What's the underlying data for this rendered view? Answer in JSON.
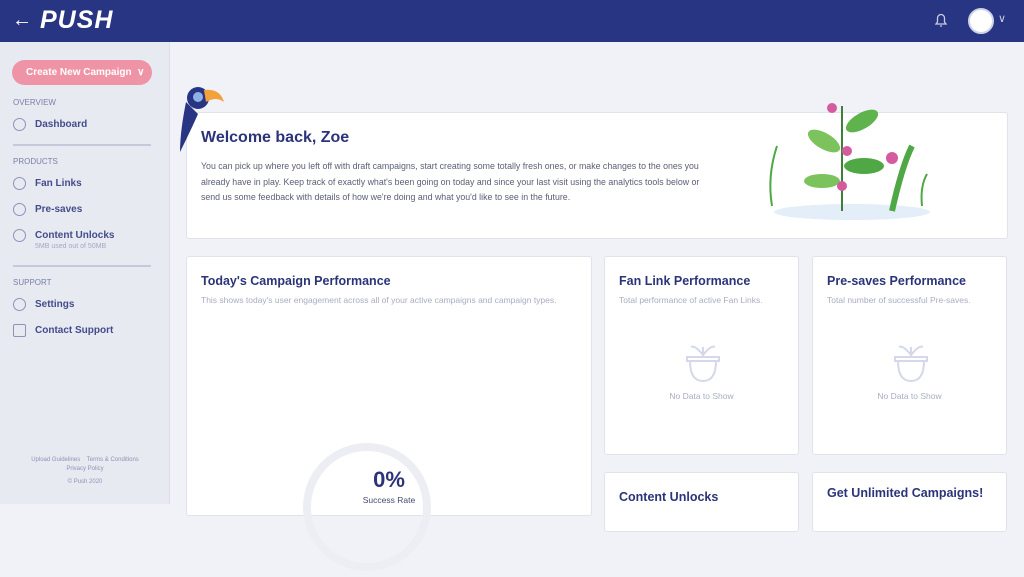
{
  "header": {
    "back_icon": "arrow-left-icon",
    "logo": "PUSH",
    "bell_icon": "bell-icon",
    "avatar_icon": "user-avatar",
    "menu_caret": "chevron-down-icon"
  },
  "sidebar": {
    "create_button": "Create New Campaign",
    "sections": [
      {
        "title": "OVERVIEW",
        "items": [
          {
            "label": "Dashboard",
            "icon": "dashboard-icon"
          }
        ]
      },
      {
        "title": "PRODUCTS",
        "items": [
          {
            "label": "Fan Links",
            "icon": "link-icon"
          },
          {
            "label": "Pre-saves",
            "icon": "presave-icon"
          },
          {
            "label": "Content Unlocks",
            "icon": "lock-icon",
            "sub": "5MB used out of 50MB"
          }
        ]
      },
      {
        "title": "SUPPORT",
        "items": [
          {
            "label": "Settings",
            "icon": "gear-icon"
          },
          {
            "label": "Contact Support",
            "icon": "chat-icon"
          }
        ]
      }
    ],
    "footer": {
      "upload": "Upload Guidelines",
      "terms": "Terms & Conditions",
      "privacy": "Privacy Policy",
      "copyright": "© Push 2020"
    }
  },
  "welcome": {
    "title": "Welcome back, Zoe",
    "text": "You can pick up where you left off with draft campaigns, start creating some totally fresh ones, or make changes to the ones you already have in play. Keep track of exactly what's been going on today and since your last visit using the analytics tools below or send us some feedback with details of how we're doing and what you'd like to see in the future."
  },
  "today": {
    "title": "Today's Campaign Performance",
    "desc": "This shows today's user engagement across all of your active campaigns and campaign types.",
    "value": "0%",
    "value_label": "Success Rate",
    "success_rate": 0
  },
  "fanlink": {
    "title": "Fan Link Performance",
    "desc": "Total performance of active Fan Links.",
    "empty": "No Data to Show"
  },
  "presaves": {
    "title": "Pre-saves Performance",
    "desc": "Total number of successful Pre-saves.",
    "empty": "No Data to Show"
  },
  "unlocks": {
    "title": "Content Unlocks"
  },
  "unlimited": {
    "title": "Get Unlimited Campaigns!"
  },
  "colors": {
    "header": "#283583",
    "accent": "#ef94a6",
    "heading": "#2b3479"
  }
}
